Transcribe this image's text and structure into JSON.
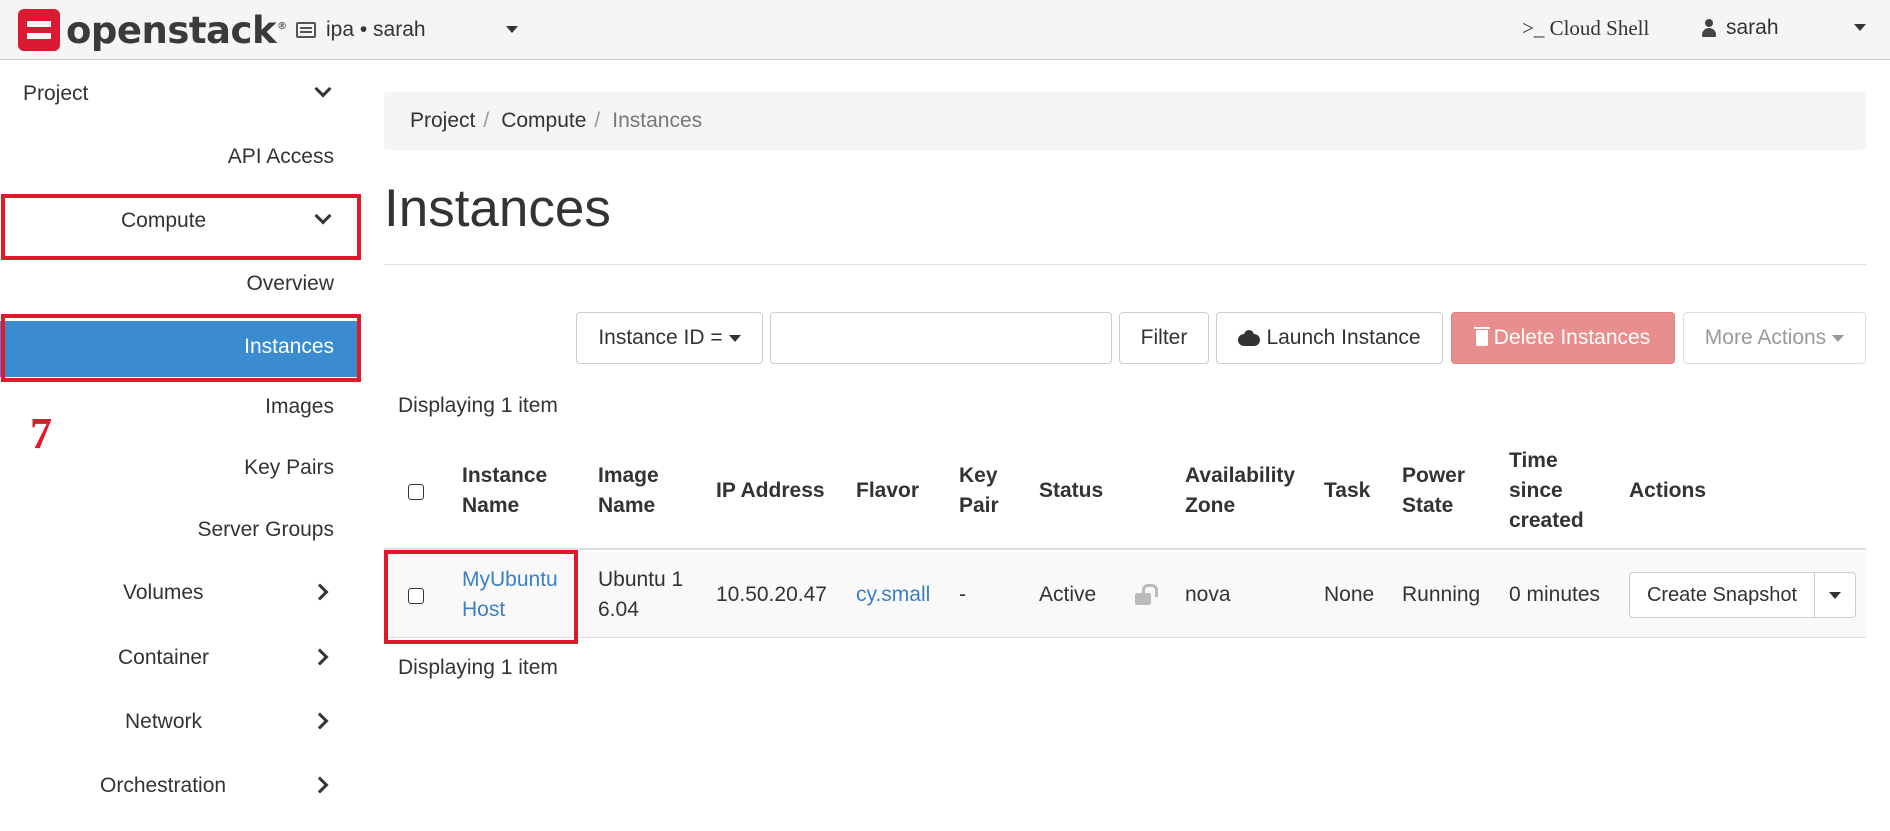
{
  "topbar": {
    "logo_text": "openstack",
    "logo_reg": "®",
    "project_switcher": "ipa • sarah",
    "cloud_shell": ">_ Cloud Shell",
    "user": "sarah"
  },
  "sidebar": {
    "project": "Project",
    "api_access": "API Access",
    "compute": "Compute",
    "overview": "Overview",
    "instances": "Instances",
    "images": "Images",
    "key_pairs": "Key Pairs",
    "server_groups": "Server Groups",
    "volumes": "Volumes",
    "container": "Container",
    "network": "Network",
    "orchestration": "Orchestration"
  },
  "annotation": {
    "step_marker": "7"
  },
  "breadcrumb": {
    "project": "Project",
    "compute": "Compute",
    "current": "Instances",
    "separator": "/"
  },
  "main": {
    "title": "Instances",
    "filter_select": "Instance ID =",
    "filter_input_value": "",
    "filter_button": "Filter",
    "launch_button": "Launch Instance",
    "delete_button": "Delete Instances",
    "more_actions": "More Actions",
    "display_count_top": "Displaying 1 item",
    "display_count_bottom": "Displaying 1 item"
  },
  "table": {
    "headers": {
      "instance_name_1": "Instance",
      "instance_name_2": "Name",
      "image_name_1": "Image",
      "image_name_2": "Name",
      "ip_address": "IP Address",
      "flavor": "Flavor",
      "key_pair_1": "Key",
      "key_pair_2": "Pair",
      "status": "Status",
      "az_1": "Availability",
      "az_2": "Zone",
      "task": "Task",
      "power_1": "Power",
      "power_2": "State",
      "time_1": "Time",
      "time_2": "since",
      "time_3": "created",
      "actions": "Actions"
    },
    "rows": [
      {
        "instance_name_1": "MyUbuntu",
        "instance_name_2": "Host",
        "image_name_1": "Ubuntu 1",
        "image_name_2": "6.04",
        "ip_address": "10.50.20.47",
        "flavor": "cy.small",
        "key_pair": "-",
        "status": "Active",
        "availability_zone": "nova",
        "task": "None",
        "power_state": "Running",
        "time_since_created": "0 minutes",
        "action_button": "Create Snapshot"
      }
    ]
  },
  "colors": {
    "active_nav": "#3b8bd0",
    "highlight": "#e0192b",
    "danger_disabled": "#e98e8e",
    "link": "#3b7fc4"
  }
}
